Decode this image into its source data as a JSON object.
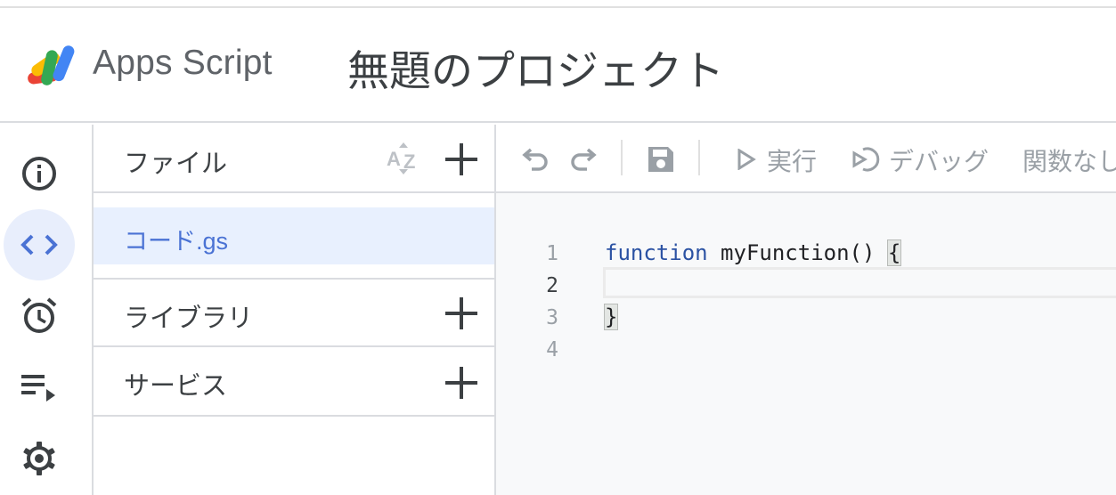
{
  "app": {
    "brand": "Apps Script",
    "project_title": "無題のプロジェクト"
  },
  "rail": {
    "items": [
      {
        "name": "overview",
        "icon": "info-icon",
        "active": false
      },
      {
        "name": "editor",
        "icon": "code-icon",
        "active": true
      },
      {
        "name": "triggers",
        "icon": "alarm-clock-icon",
        "active": false
      },
      {
        "name": "executions",
        "icon": "playlist-play-icon",
        "active": false
      },
      {
        "name": "settings",
        "icon": "gear-icon",
        "active": false
      }
    ]
  },
  "files_panel": {
    "title": "ファイル",
    "files": [
      {
        "name": "コード.gs"
      }
    ],
    "sections": [
      {
        "label": "ライブラリ"
      },
      {
        "label": "サービス"
      }
    ]
  },
  "toolbar": {
    "run_label": "実行",
    "debug_label": "デバッグ",
    "function_select": "関数なし"
  },
  "editor": {
    "line_numbers": [
      "1",
      "2",
      "3",
      "4"
    ],
    "current_line": "2",
    "code": {
      "keyword": "function",
      "fn_signature": " myFunction() ",
      "open_brace": "{",
      "close_brace": "}"
    }
  },
  "colors": {
    "accent": "#4a72d4",
    "active_bg": "#e8f0fe",
    "border": "#dadce0",
    "editor_bg": "#f8f9fa",
    "keyword": "#2b52a3"
  }
}
